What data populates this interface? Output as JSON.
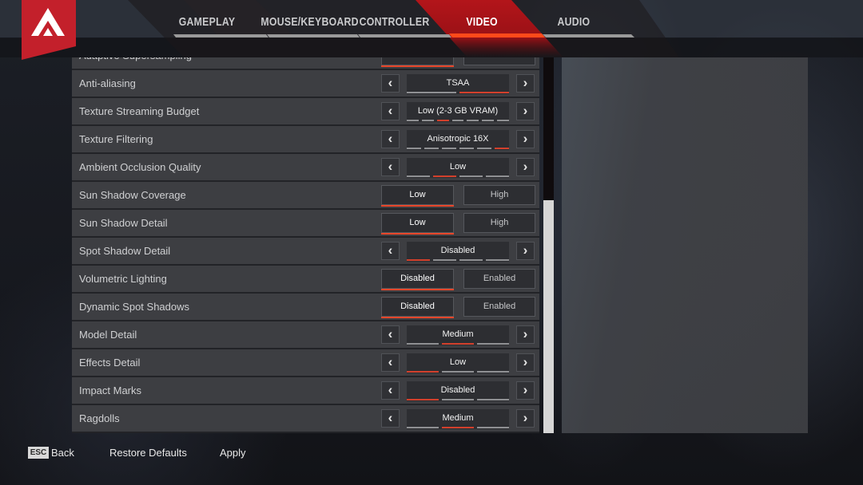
{
  "header": {
    "logo": "apex-legends-logo",
    "tabs": [
      {
        "label": "GAMEPLAY",
        "active": false
      },
      {
        "label": "MOUSE/KEYBOARD",
        "active": false
      },
      {
        "label": "CONTROLLER",
        "active": false
      },
      {
        "label": "VIDEO",
        "active": true
      },
      {
        "label": "AUDIO",
        "active": false
      }
    ]
  },
  "settings": [
    {
      "label": "Adaptive Supersampling",
      "type": "toggle",
      "options": [
        "Disabled",
        "Enabled"
      ],
      "selected": 0
    },
    {
      "label": "Anti-aliasing",
      "type": "stepper",
      "value": "TSAA",
      "segments": 2,
      "selected": 2
    },
    {
      "label": "Texture Streaming Budget",
      "type": "stepper",
      "value": "Low (2-3 GB VRAM)",
      "segments": 7,
      "selected": 3
    },
    {
      "label": "Texture Filtering",
      "type": "stepper",
      "value": "Anisotropic 16X",
      "segments": 6,
      "selected": 6
    },
    {
      "label": "Ambient Occlusion Quality",
      "type": "stepper",
      "value": "Low",
      "segments": 4,
      "selected": 2
    },
    {
      "label": "Sun Shadow Coverage",
      "type": "toggle",
      "options": [
        "Low",
        "High"
      ],
      "selected": 0
    },
    {
      "label": "Sun Shadow Detail",
      "type": "toggle",
      "options": [
        "Low",
        "High"
      ],
      "selected": 0
    },
    {
      "label": "Spot Shadow Detail",
      "type": "stepper",
      "value": "Disabled",
      "segments": 4,
      "selected": 1
    },
    {
      "label": "Volumetric Lighting",
      "type": "toggle",
      "options": [
        "Disabled",
        "Enabled"
      ],
      "selected": 0
    },
    {
      "label": "Dynamic Spot Shadows",
      "type": "toggle",
      "options": [
        "Disabled",
        "Enabled"
      ],
      "selected": 0
    },
    {
      "label": "Model Detail",
      "type": "stepper",
      "value": "Medium",
      "segments": 3,
      "selected": 2
    },
    {
      "label": "Effects Detail",
      "type": "stepper",
      "value": "Low",
      "segments": 3,
      "selected": 1
    },
    {
      "label": "Impact Marks",
      "type": "stepper",
      "value": "Disabled",
      "segments": 3,
      "selected": 1
    },
    {
      "label": "Ragdolls",
      "type": "stepper",
      "value": "Medium",
      "segments": 3,
      "selected": 2
    }
  ],
  "arrows": {
    "prev": "‹",
    "next": "›"
  },
  "scrollbar": {
    "thumb_start_fraction": 0.38,
    "thumb_size_fraction": 0.62
  },
  "footer": {
    "esc_key": "ESC",
    "back_label": "Back",
    "restore_label": "Restore Defaults",
    "apply_label": "Apply"
  },
  "colors": {
    "brand_red": "#c3202b",
    "accent_orange": "#e8462a",
    "segment_selected": "#d2402c",
    "segment_idle": "#8f9093"
  }
}
